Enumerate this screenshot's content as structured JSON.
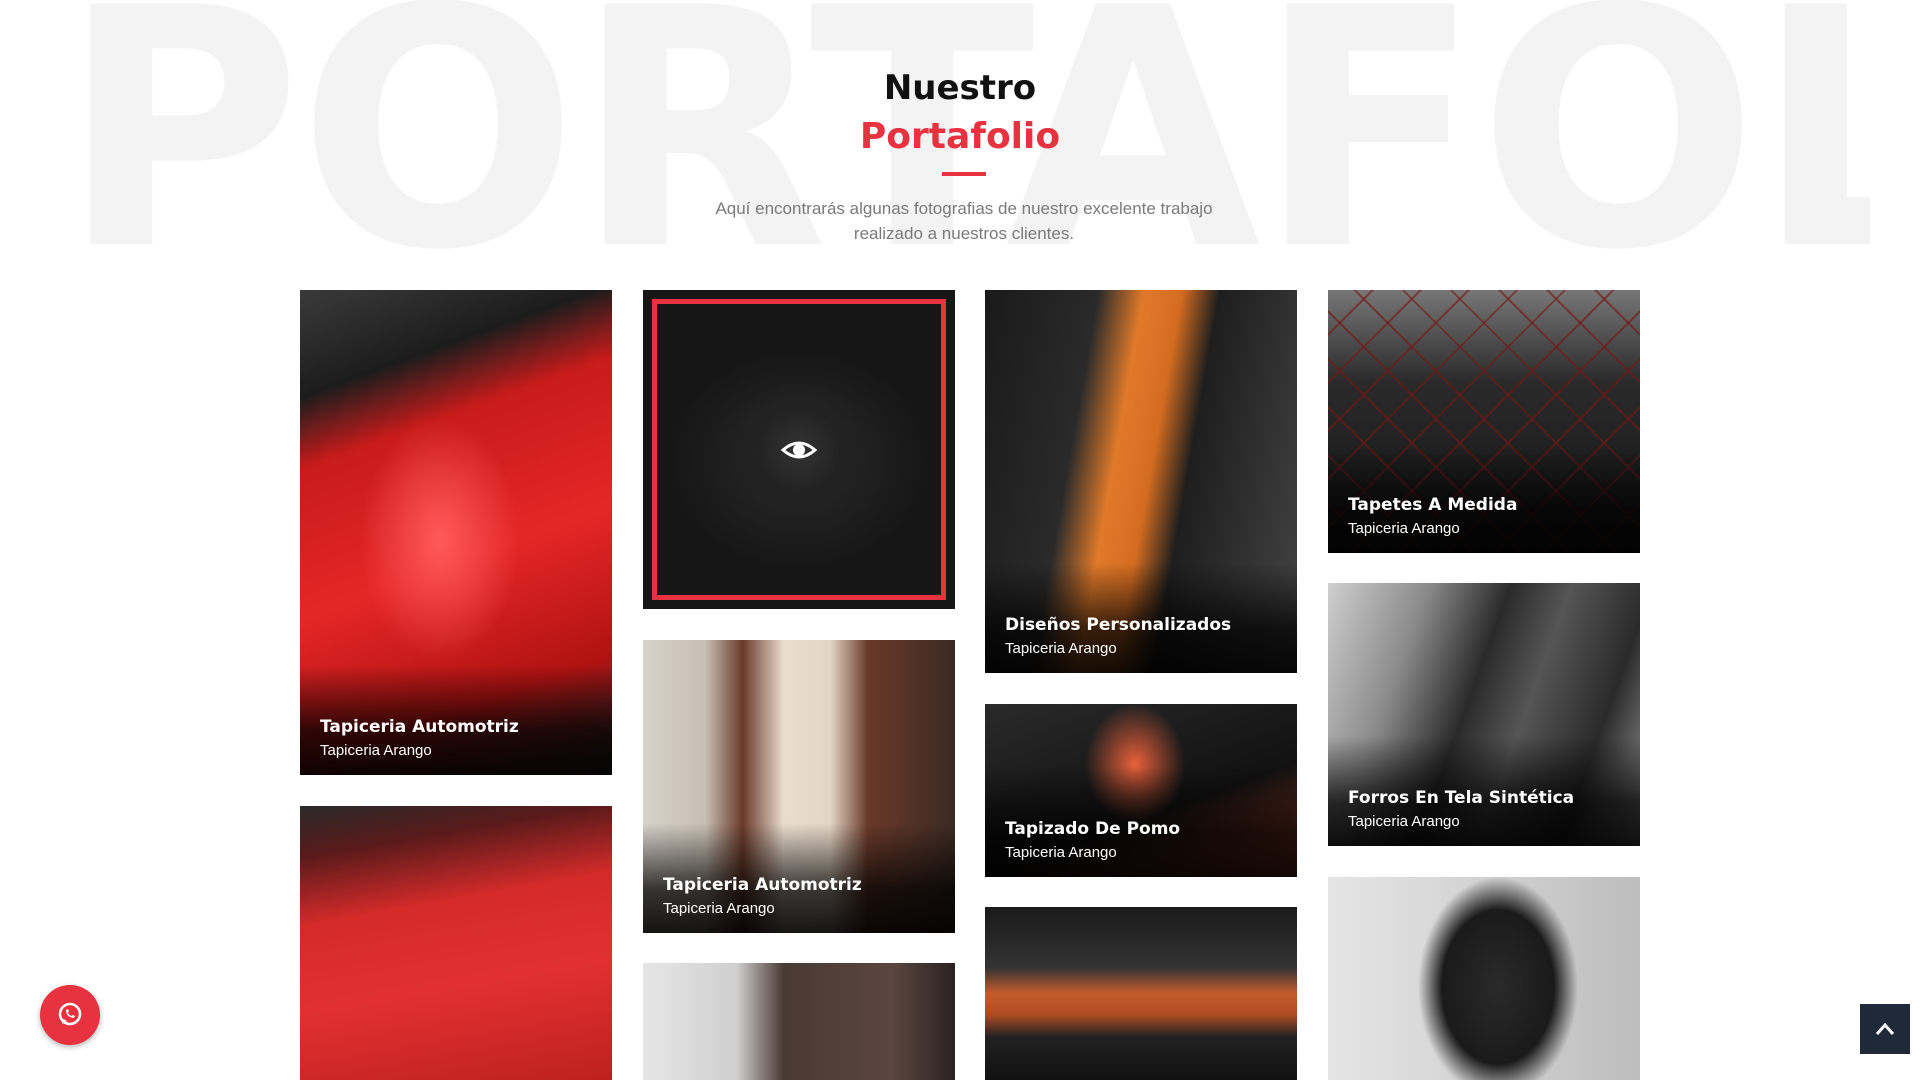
{
  "background_word": "PORTAFOLIO",
  "header": {
    "title_small": "Nuestro",
    "title_big": "Portafolio",
    "subtitle": "Aquí encontrarás algunas fotografias de nuestro excelente trabajo realizado a nuestros clientes."
  },
  "colors": {
    "accent": "#e8323f",
    "dark": "#1e2a38",
    "bg_word": "#f3f3f3"
  },
  "portfolio": [
    {
      "title": "Tapiceria Automotriz",
      "subtitle": "Tapiceria Arango"
    },
    {
      "title": "",
      "subtitle": ""
    },
    {
      "title": "Diseños Personalizados",
      "subtitle": "Tapiceria Arango"
    },
    {
      "title": "Tapetes A Medida",
      "subtitle": "Tapiceria Arango"
    },
    {
      "title": "Tapiceria Automotriz",
      "subtitle": "Tapiceria Arango"
    },
    {
      "title": "Tapizado De Pomo",
      "subtitle": "Tapiceria Arango"
    },
    {
      "title": "Forros En Tela Sintética",
      "subtitle": "Tapiceria Arango"
    }
  ],
  "icons": {
    "view": "eye-icon",
    "whatsapp": "whatsapp-icon",
    "scroll_top": "chevron-up-icon"
  }
}
